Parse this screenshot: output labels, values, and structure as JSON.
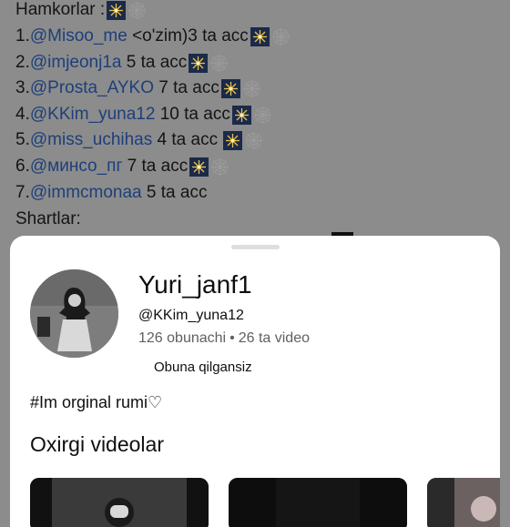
{
  "post": {
    "header": "Hamkorlar :",
    "partners": [
      {
        "num": "1.",
        "handle": "@Misoo_me",
        "rest": " <o'zim)3 ta acc"
      },
      {
        "num": "2.",
        "handle": "@imjeonj1a",
        "rest": " 5 ta acc"
      },
      {
        "num": "3.",
        "handle": "@Prosta_AYKO",
        "rest": " 7 ta acc"
      },
      {
        "num": "4.",
        "handle": "@KKim_yuna12",
        "rest": " 10 ta acc"
      },
      {
        "num": "5.",
        "handle": "@miss_uchihas",
        "rest": " 4 ta acc"
      },
      {
        "num": "6.",
        "handle": "@минсо_пг",
        "rest": " 7 ta acc"
      },
      {
        "num": "7.",
        "handle": "@immcmonaa",
        "rest": " 5 ta acc"
      }
    ],
    "conditions_label": "Shartlar:",
    "emoji_icons": [
      "fireworks-icon",
      "spider-web-icon"
    ],
    "mention_color": "#1d3f7a"
  },
  "channel_sheet": {
    "name": "Yuri_janf1",
    "handle": "@KKim_yuna12",
    "subscribers": "126 obunachi",
    "separator": "•",
    "videos": "26 ta video",
    "subscribe_status": "Obuna qilgansiz",
    "description": "#Im orginal rumi♡",
    "recent_videos_title": "Oxirgi videolar"
  }
}
